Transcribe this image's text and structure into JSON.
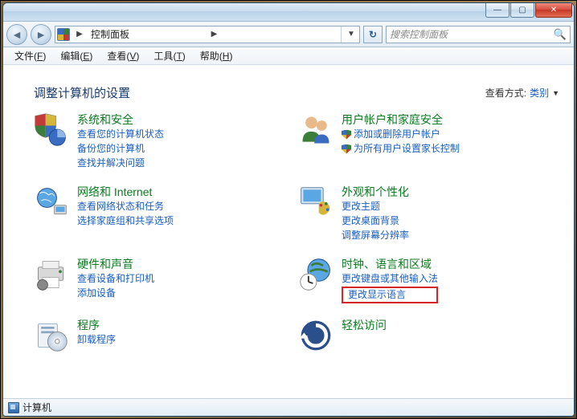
{
  "titlebar": {
    "min": "—",
    "max": "▢",
    "close": "✕"
  },
  "nav": {
    "back": "◄",
    "forward": "►",
    "breadcrumb_root": "控制面板",
    "breadcrumb_sep": "▶",
    "history_arrow": "▼",
    "refresh": "↻",
    "search_placeholder": "搜索控制面板"
  },
  "menubar": {
    "items": [
      {
        "label": "文件",
        "key": "F"
      },
      {
        "label": "编辑",
        "key": "E"
      },
      {
        "label": "查看",
        "key": "V"
      },
      {
        "label": "工具",
        "key": "T"
      },
      {
        "label": "帮助",
        "key": "H"
      }
    ]
  },
  "content": {
    "heading": "调整计算机的设置",
    "view_label": "查看方式:",
    "view_value": "类别",
    "drop": "▼"
  },
  "cats": {
    "sys": {
      "title": "系统和安全",
      "l1": "查看您的计算机状态",
      "l2": "备份您的计算机",
      "l3": "查找并解决问题"
    },
    "user": {
      "title": "用户帐户和家庭安全",
      "l1": "添加或删除用户帐户",
      "l2": "为所有用户设置家长控制"
    },
    "net": {
      "title": "网络和 Internet",
      "l1": "查看网络状态和任务",
      "l2": "选择家庭组和共享选项"
    },
    "appr": {
      "title": "外观和个性化",
      "l1": "更改主题",
      "l2": "更改桌面背景",
      "l3": "调整屏幕分辨率"
    },
    "hw": {
      "title": "硬件和声音",
      "l1": "查看设备和打印机",
      "l2": "添加设备"
    },
    "clock": {
      "title": "时钟、语言和区域",
      "l1": "更改键盘或其他输入法",
      "l2": "更改显示语言"
    },
    "prog": {
      "title": "程序",
      "l1": "卸载程序"
    },
    "ease": {
      "title": "轻松访问"
    }
  },
  "statusbar": {
    "label": "计算机"
  }
}
